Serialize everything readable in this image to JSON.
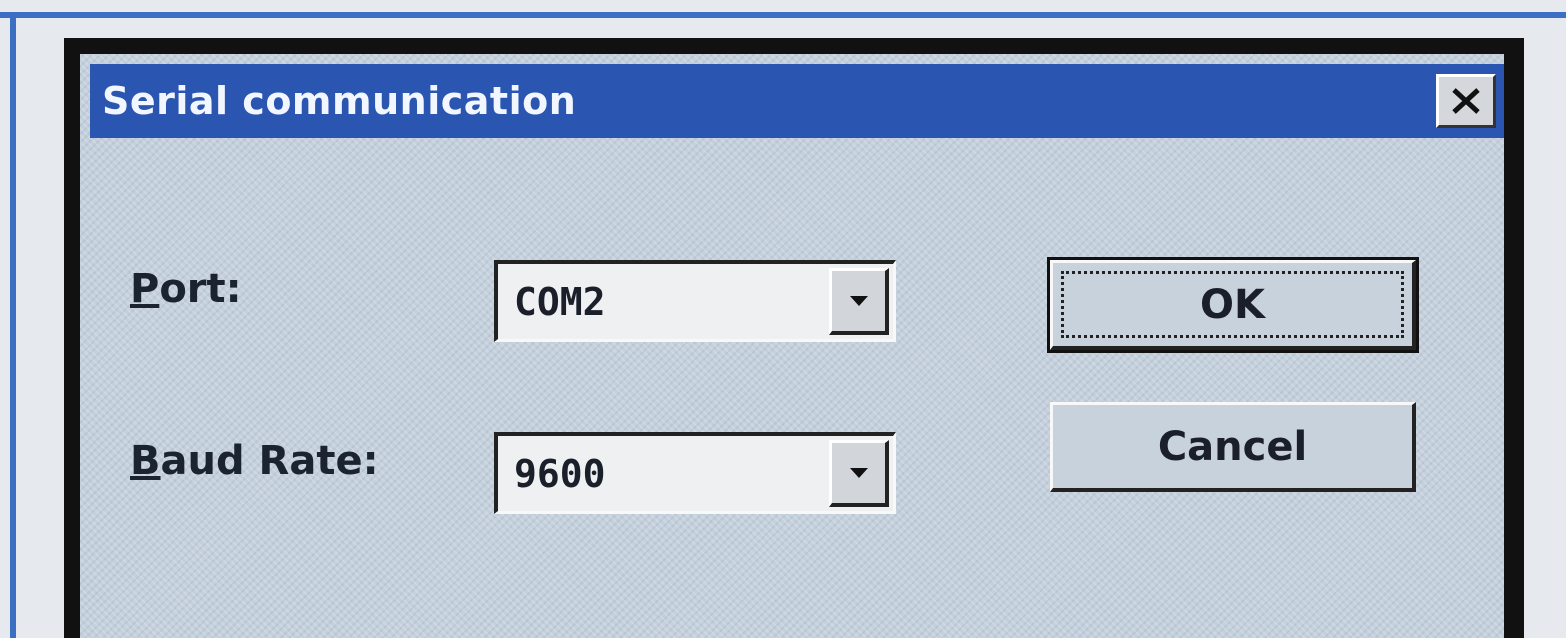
{
  "dialog": {
    "title": "Serial communication",
    "close_icon": "close-icon"
  },
  "port": {
    "label_mnemonic": "P",
    "label_rest": "ort:",
    "value": "COM2",
    "dropdown_icon": "chevron-down-icon"
  },
  "baud_rate": {
    "label_mnemonic": "B",
    "label_rest": "aud Rate:",
    "value": "9600",
    "dropdown_icon": "chevron-down-icon"
  },
  "buttons": {
    "ok_label": "OK",
    "cancel_label": "Cancel"
  },
  "colors": {
    "titlebar": "#2a55b0",
    "dialog_face": "#c4d0dc",
    "frame_accent": "#3a6fc4"
  }
}
